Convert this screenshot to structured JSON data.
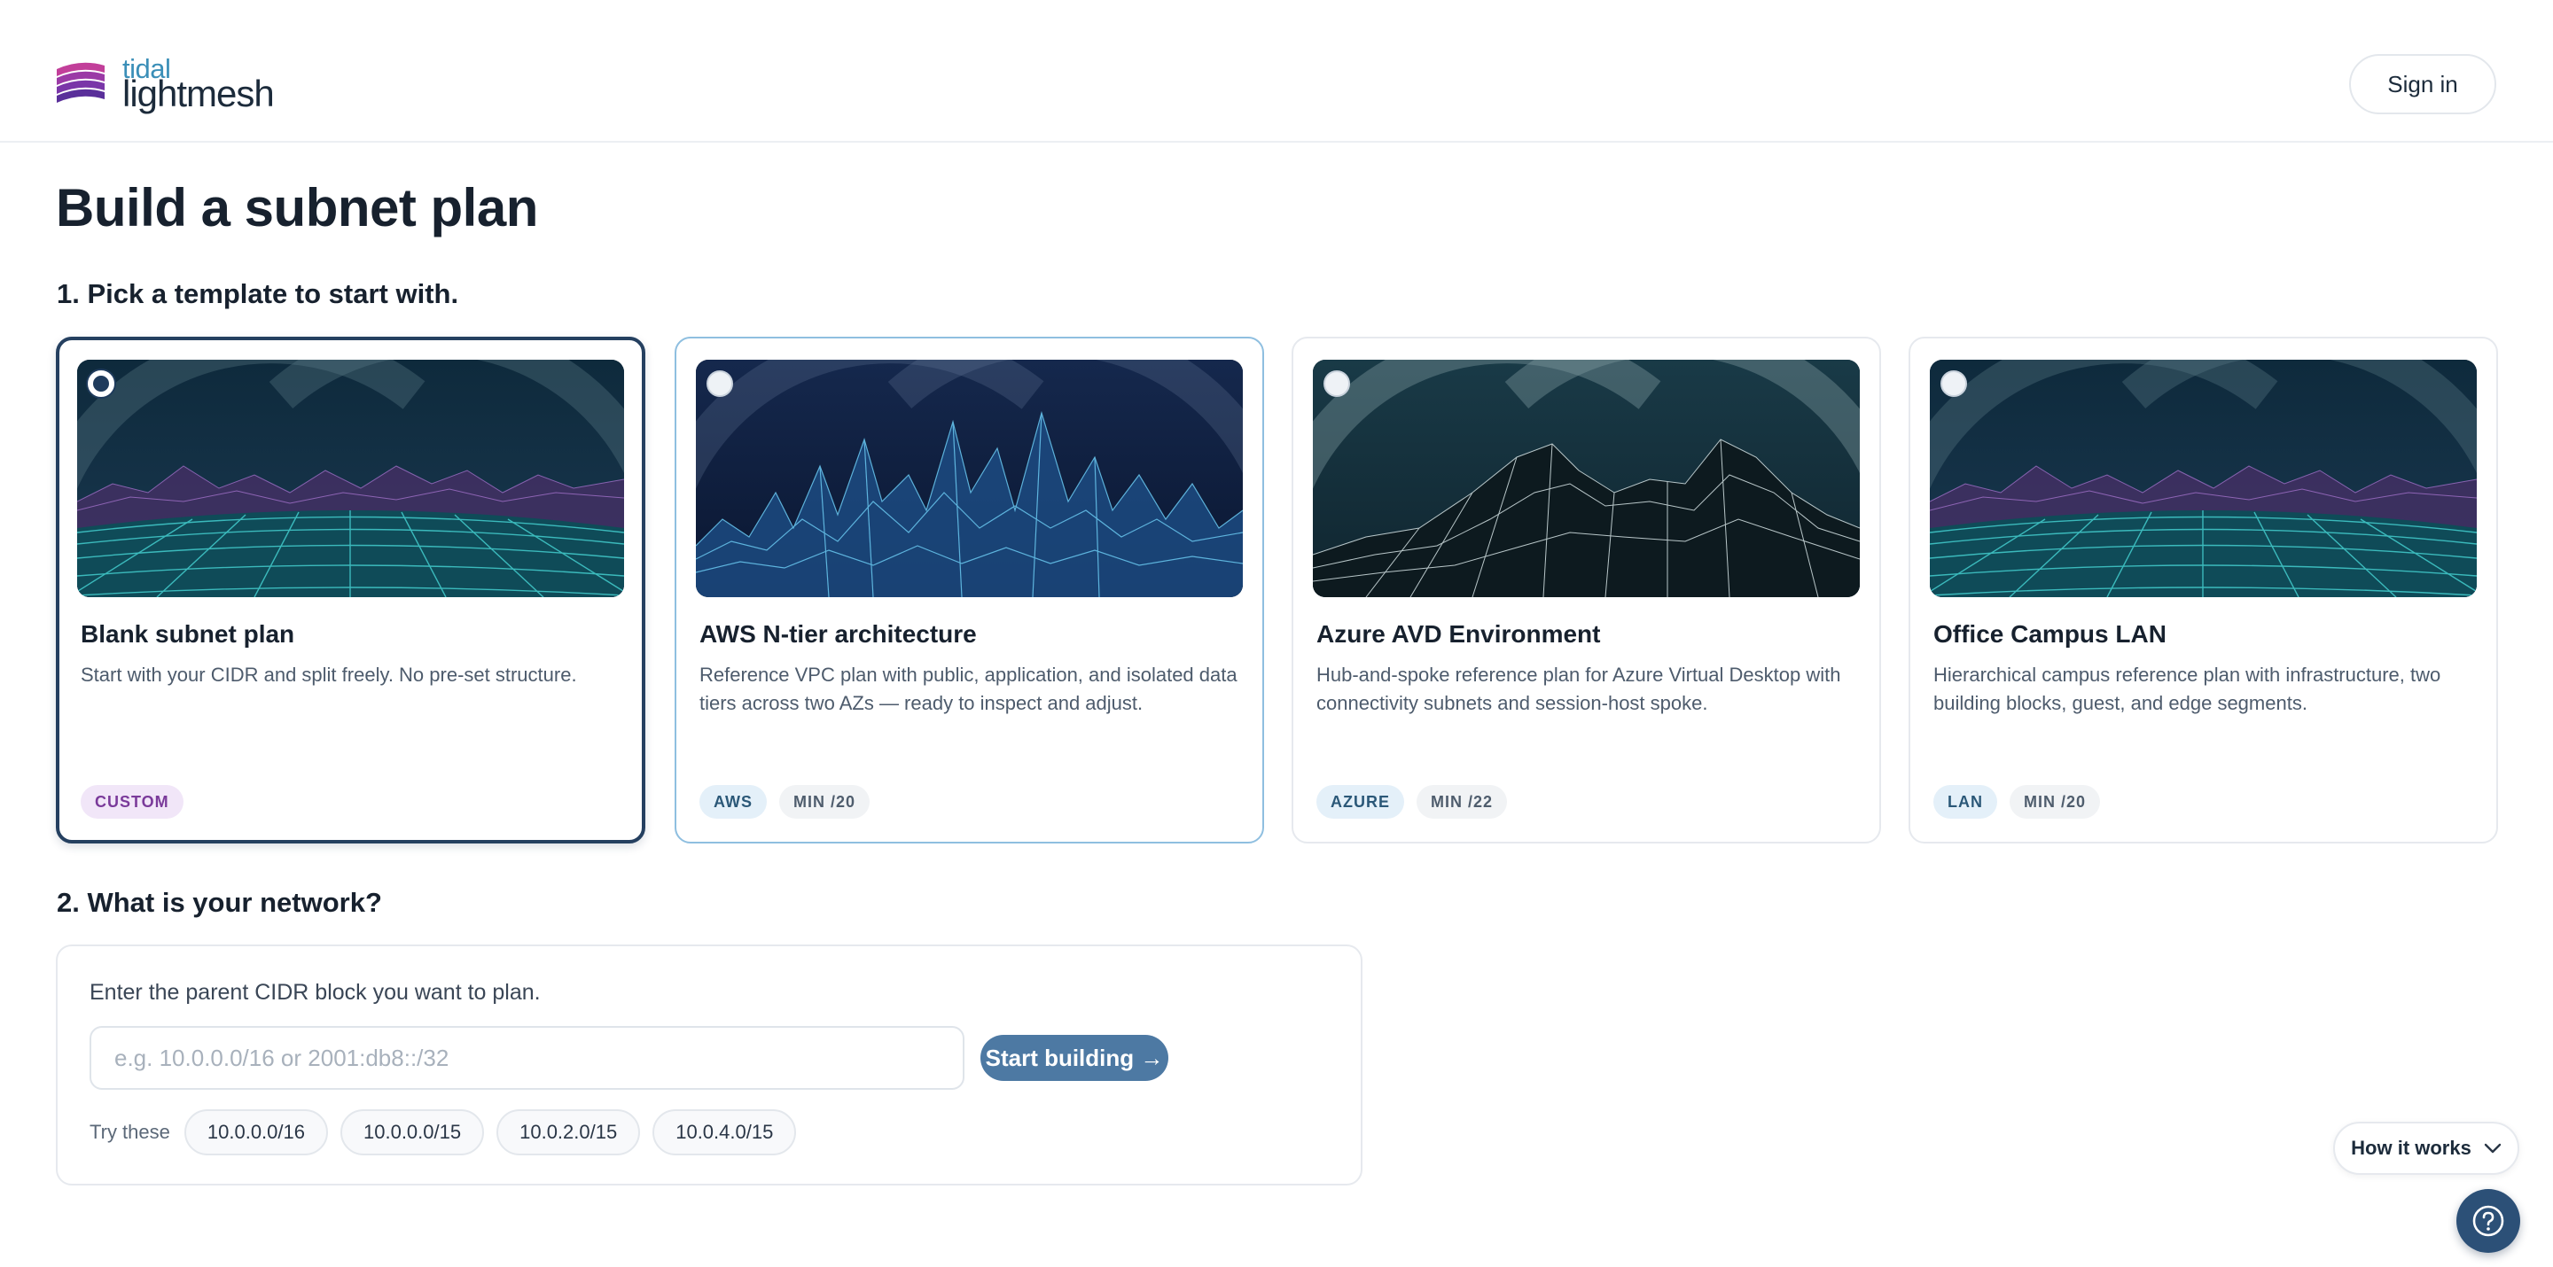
{
  "header": {
    "logo_top": "tidal",
    "logo_bottom": "lightmesh",
    "sign_in_label": "Sign in"
  },
  "page": {
    "title": "Build a subnet plan",
    "step1": "1. Pick a template to start with.",
    "step2": "2. What is your network?"
  },
  "templates": [
    {
      "title": "Blank subnet plan",
      "description": "Start with your CIDR and split freely. No pre-set structure.",
      "tags": [
        "CUSTOM"
      ],
      "selected": true
    },
    {
      "title": "AWS N-tier architecture",
      "description": "Reference VPC plan with public, application, and isolated data tiers across two AZs — ready to inspect and adjust.",
      "tags": [
        "AWS",
        "MIN /20"
      ],
      "selected": false
    },
    {
      "title": "Azure AVD Environment",
      "description": "Hub-and-spoke reference plan for Azure Virtual Desktop with connectivity subnets and session-host spoke.",
      "tags": [
        "AZURE",
        "MIN /22"
      ],
      "selected": false
    },
    {
      "title": "Office Campus LAN",
      "description": "Hierarchical campus reference plan with infrastructure, two building blocks, guest, and edge segments.",
      "tags": [
        "LAN",
        "MIN /20"
      ],
      "selected": false
    }
  ],
  "network": {
    "label": "Enter the parent CIDR block you want to plan.",
    "input_value": "",
    "input_placeholder": "e.g. 10.0.0.0/16 or 2001:db8::/32",
    "start_label": "Start building →",
    "try_label": "Try these",
    "suggestions": [
      "10.0.0.0/16",
      "10.0.0.0/15",
      "10.0.2.0/15",
      "10.0.4.0/15"
    ]
  },
  "floating": {
    "how_it_works_label": "How it works",
    "help_icon": "question-circle-icon"
  },
  "colors": {
    "accent": "#4d79a3",
    "selected_border": "#254060",
    "logo_teal": "#3b8fb8",
    "logo_purple": "#7b3fa8"
  }
}
